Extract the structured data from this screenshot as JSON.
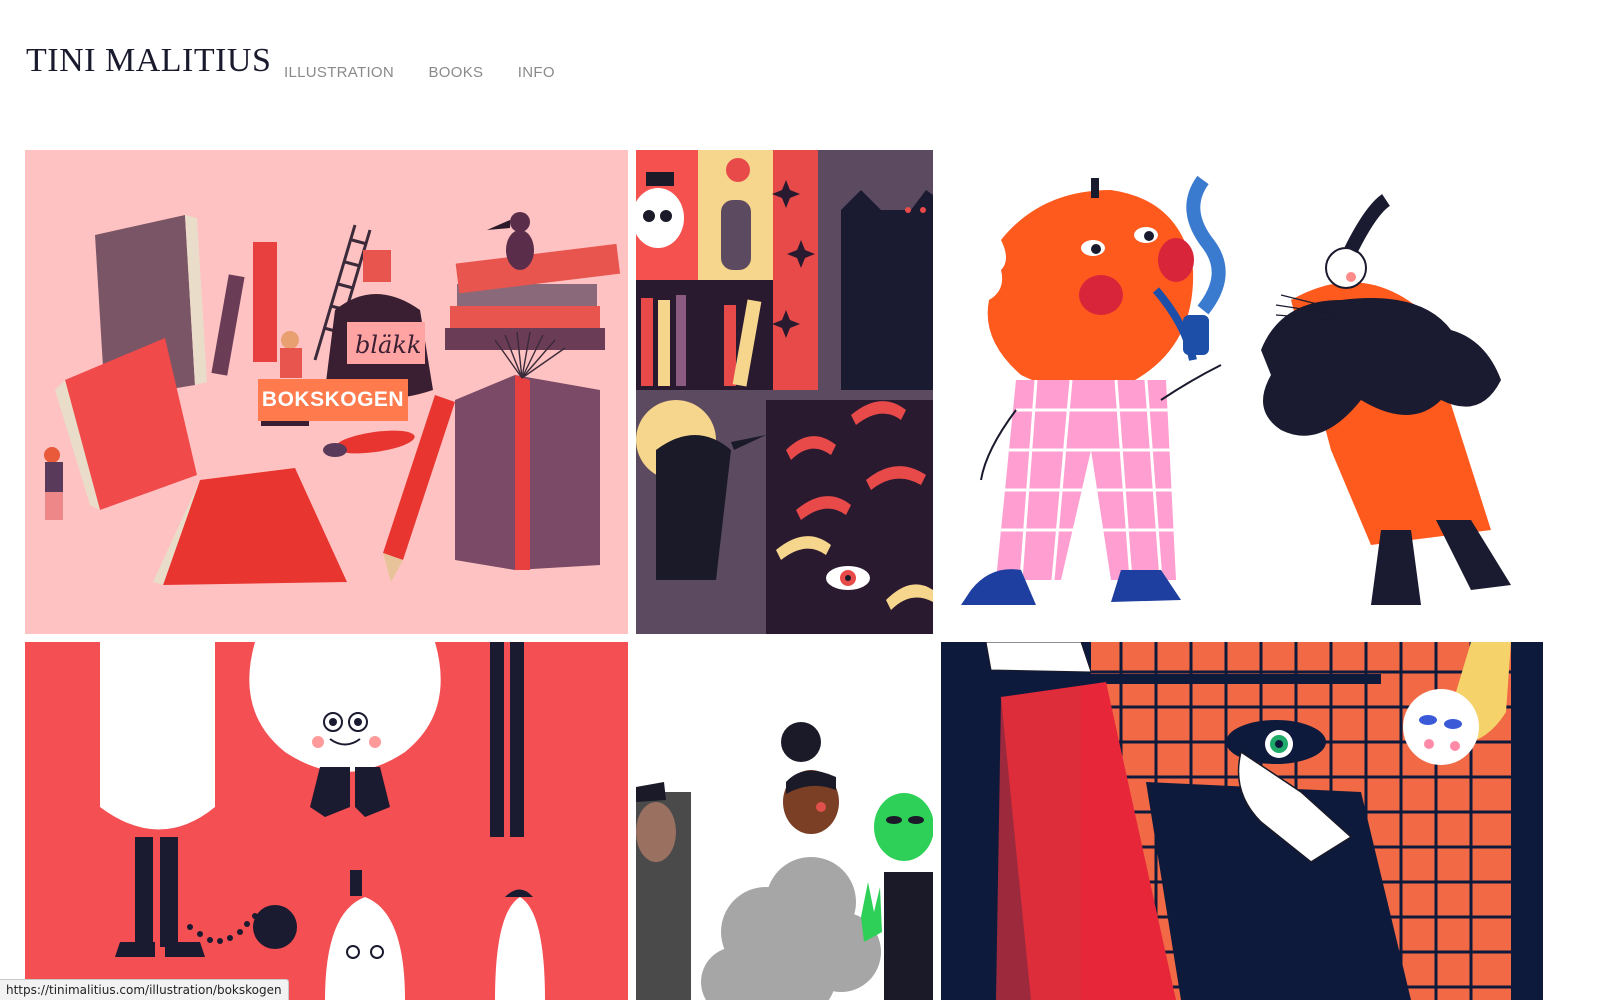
{
  "site": {
    "title": "TINI MALITIUS"
  },
  "nav": {
    "items": [
      "ILLUSTRATION",
      "BOOKS",
      "INFO"
    ]
  },
  "gallery": {
    "tiles": [
      {
        "overlay_label": "BOKSKOGEN",
        "illustration_text": "bläkk",
        "bg": "#ffc2c2"
      },
      {
        "bg": "#5b4a60"
      },
      {
        "bg": "#ffffff"
      },
      {
        "bg": "#f44f52"
      },
      {
        "bg": "#ffffff"
      },
      {
        "bg": "#0e1a3c"
      }
    ]
  },
  "status_bar": {
    "url": "https://tinimalitius.com/illustration/bokskogen"
  }
}
